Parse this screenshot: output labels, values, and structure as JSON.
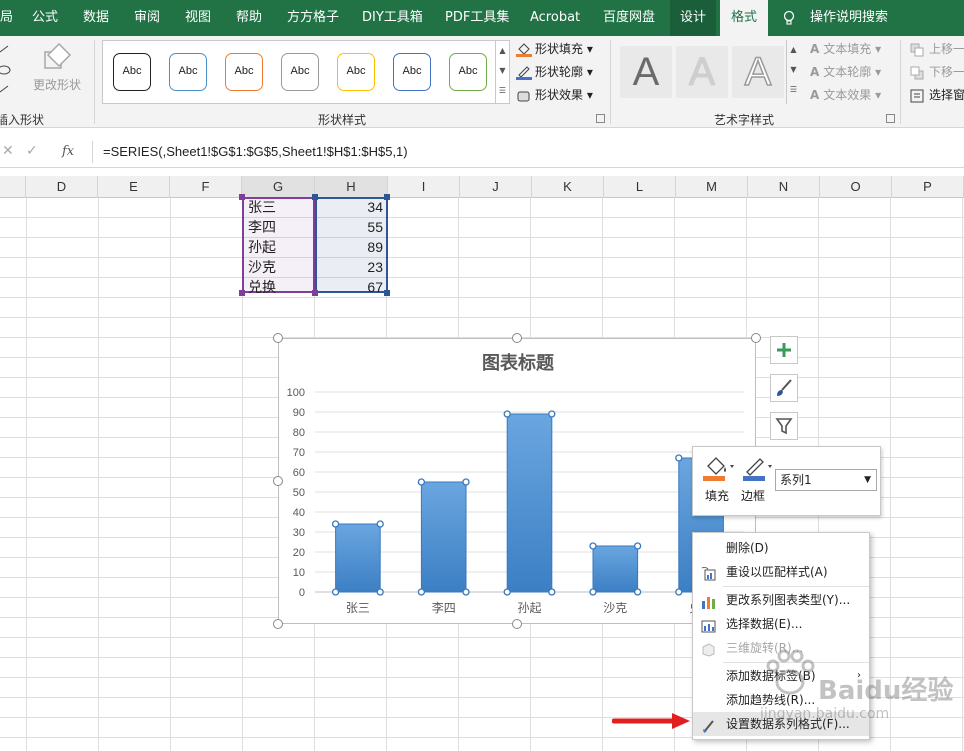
{
  "ribbon": {
    "tabs": [
      {
        "label": "局"
      },
      {
        "label": "公式"
      },
      {
        "label": "数据"
      },
      {
        "label": "审阅"
      },
      {
        "label": "视图"
      },
      {
        "label": "帮助"
      },
      {
        "label": "方方格子"
      },
      {
        "label": "DIY工具箱"
      },
      {
        "label": "PDF工具集"
      },
      {
        "label": "Acrobat"
      },
      {
        "label": "百度网盘"
      },
      {
        "label": "设计"
      },
      {
        "label": "格式"
      }
    ],
    "active_tab": "格式",
    "search": "操作说明搜索",
    "insert_shapes": {
      "change_shape": "更改形状",
      "group_label": "插入形状"
    },
    "shape_styles": {
      "swatch_text": "Abc",
      "swatches": [
        "#222222",
        "#4a90c8",
        "#ed7d31",
        "#9a9a9a",
        "#ffc000",
        "#4472c4",
        "#70ad47"
      ],
      "fill": "形状填充",
      "outline": "形状轮廓",
      "effects": "形状效果",
      "group_label": "形状样式"
    },
    "wordart": {
      "letter": "A",
      "text_fill": "文本填充",
      "text_outline": "文本轮廓",
      "text_effects": "文本效果",
      "group_label": "艺术字样式"
    },
    "arrange": {
      "bring_forward": "上移一",
      "send_backward": "下移一",
      "selection_pane": "选择窗"
    }
  },
  "formula_bar": {
    "fx": "fx",
    "formula": "=SERIES(,Sheet1!$G$1:$G$5,Sheet1!$H$1:$H$5,1)"
  },
  "columns": [
    "D",
    "E",
    "F",
    "G",
    "H",
    "I",
    "J",
    "K",
    "L",
    "M",
    "N",
    "O",
    "P"
  ],
  "table": {
    "names": [
      "张三",
      "李四",
      "孙起",
      "沙克",
      "兑换"
    ],
    "values": [
      "34",
      "55",
      "89",
      "23",
      "67"
    ]
  },
  "chart_data": {
    "type": "bar",
    "title": "图表标题",
    "categories": [
      "张三",
      "李四",
      "孙起",
      "沙克",
      "兑换"
    ],
    "series": [
      {
        "name": "系列1",
        "values": [
          34,
          55,
          89,
          23,
          67
        ]
      }
    ],
    "ylim": [
      0,
      100
    ],
    "yticks": [
      0,
      10,
      20,
      30,
      40,
      50,
      60,
      70,
      80,
      90,
      100
    ],
    "grid": true,
    "bar_color": "#4a8fd4"
  },
  "mini_toolbar": {
    "fill": "填充",
    "border": "边框",
    "series_value": "系列1"
  },
  "context_menu": {
    "items": [
      {
        "label": "删除(D)"
      },
      {
        "label": "重设以匹配样式(A)"
      },
      {
        "label": "更改系列图表类型(Y)..."
      },
      {
        "label": "选择数据(E)..."
      },
      {
        "label": "三维旋转(R)..."
      },
      {
        "label": "添加数据标签(B)"
      },
      {
        "label": "添加趋势线(R)..."
      },
      {
        "label": "设置数据系列格式(F)..."
      }
    ]
  },
  "watermark": {
    "brand": "Baidu经验",
    "url": "jingyan.baidu.com"
  },
  "colors": {
    "excel_green": "#217346",
    "range_purple": "#7f3f98",
    "range_blue": "#2f5597",
    "arrow_red": "#e02020"
  }
}
